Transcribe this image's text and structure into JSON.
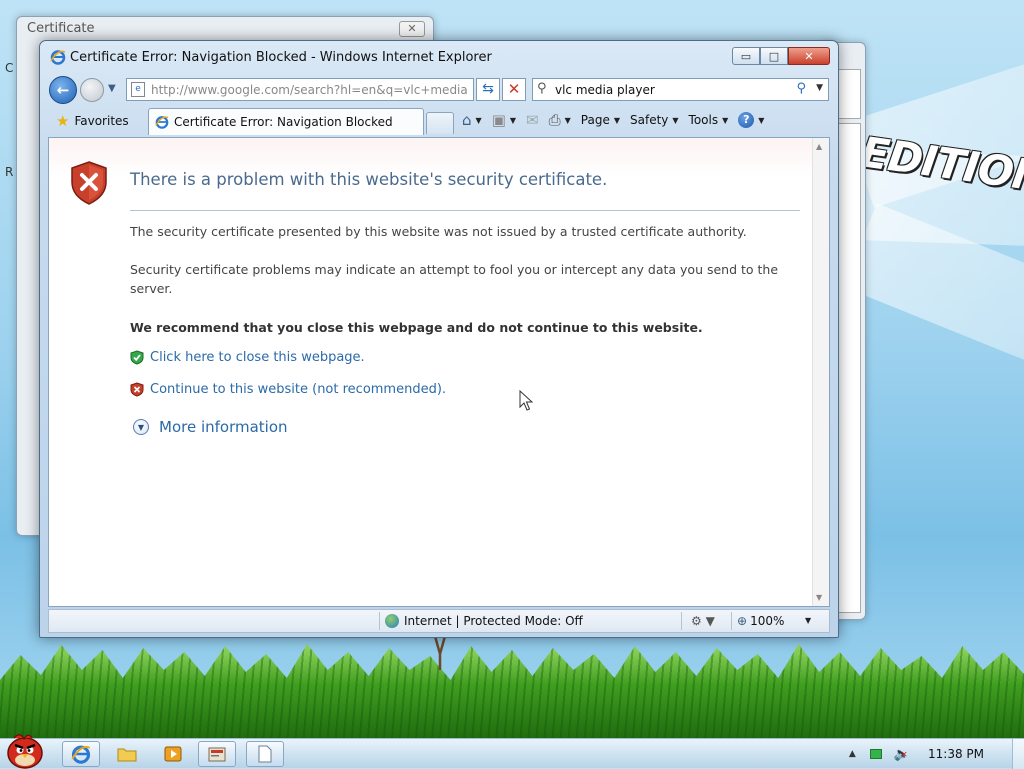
{
  "background_window": {
    "title": "Certificate",
    "close_glyph": "✕",
    "side_text_1": "C",
    "side_text_2": "R"
  },
  "desktop": {
    "wallpaper_text": "EDITION"
  },
  "window": {
    "title": "Certificate Error: Navigation Blocked - Windows Internet Explorer",
    "controls": {
      "minimize": "▭",
      "maximize": "□",
      "close": "✕"
    }
  },
  "addressbar": {
    "url": "http://www.google.com/search?hl=en&q=vlc+media",
    "search_value": "vlc media player"
  },
  "tabs": {
    "favorites_label": "Favorites",
    "active_tab_label": "Certificate Error: Navigation Blocked"
  },
  "commandbar": {
    "page": "Page",
    "safety": "Safety",
    "tools": "Tools",
    "help": "?"
  },
  "page": {
    "title": "There is a problem with this website's security certificate.",
    "para1": "The security certificate presented by this website was not issued by a trusted certificate authority.",
    "para2": "Security certificate problems may indicate an attempt to fool you or intercept any data you send to the server.",
    "recommend": "We recommend that you close this webpage and do not continue to this website.",
    "close_link": "Click here to close this webpage.",
    "continue_link": "Continue to this website (not recommended).",
    "more_info": "More information"
  },
  "statusbar": {
    "zone": "Internet | Protected Mode: Off",
    "zoom": "100%"
  },
  "taskbar": {
    "clock": "11:38 PM"
  },
  "colors": {
    "accent": "#2b6aa8",
    "title_blue": "#4a6a8d",
    "error_red": "#c8402b",
    "ok_green": "#35a848"
  }
}
